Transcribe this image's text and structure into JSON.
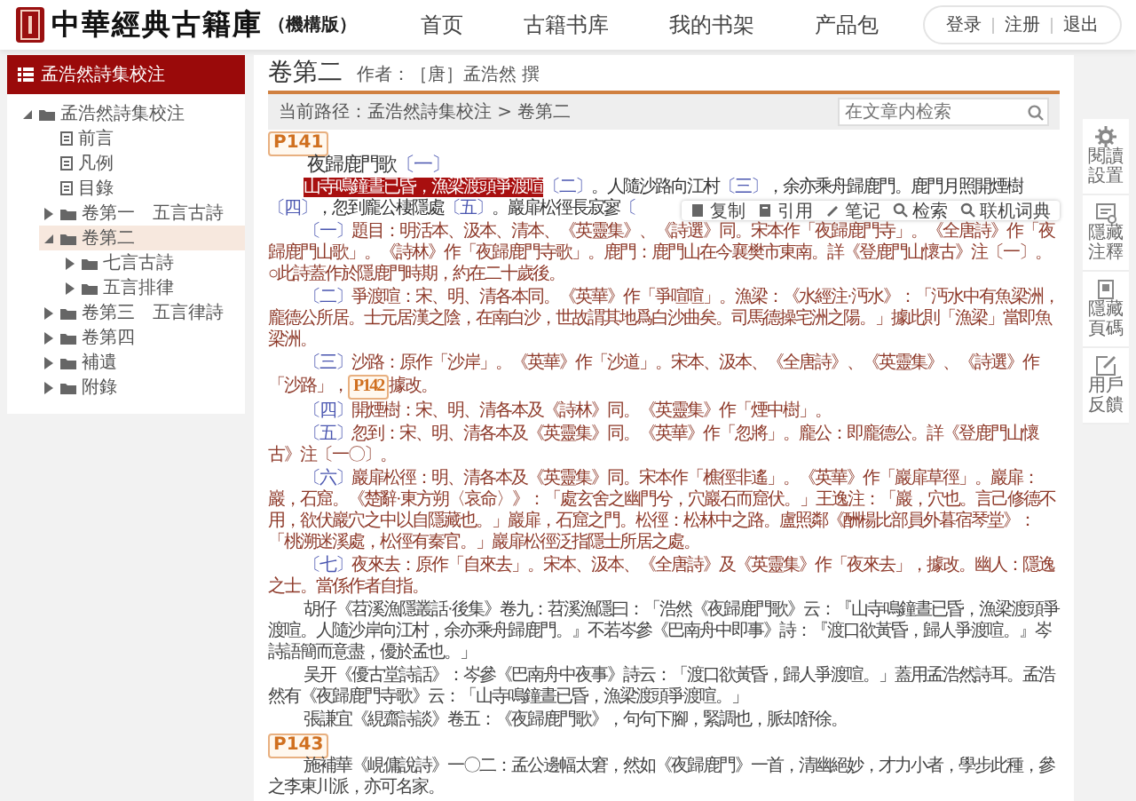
{
  "header": {
    "logo_title": "中華經典古籍庫",
    "edition": "（機構版）",
    "nav": [
      {
        "label": "首页"
      },
      {
        "label": "古籍书库"
      },
      {
        "label": "我的书架"
      },
      {
        "label": "产品包"
      }
    ],
    "account": [
      "登录",
      "注册",
      "退出"
    ]
  },
  "sidebar": {
    "title": "孟浩然詩集校注",
    "tree": [
      {
        "label": "孟浩然詩集校注",
        "kind": "folder",
        "expanded": true,
        "selected": false,
        "children": [
          {
            "label": "前言",
            "kind": "doc",
            "selected": false
          },
          {
            "label": "凡例",
            "kind": "doc",
            "selected": false
          },
          {
            "label": "目錄",
            "kind": "doc",
            "selected": false
          },
          {
            "label": "卷第一　五言古詩",
            "kind": "folder",
            "expanded": false,
            "selected": false
          },
          {
            "label": "卷第二",
            "kind": "folder",
            "expanded": true,
            "selected": true,
            "children": [
              {
                "label": "七言古詩",
                "kind": "folder",
                "expanded": false,
                "selected": false
              },
              {
                "label": "五言排律",
                "kind": "folder",
                "expanded": false,
                "selected": false
              }
            ]
          },
          {
            "label": "卷第三　五言律詩",
            "kind": "folder",
            "expanded": false,
            "selected": false
          },
          {
            "label": "卷第四",
            "kind": "folder",
            "expanded": false,
            "selected": false
          },
          {
            "label": "補遺",
            "kind": "folder",
            "expanded": false,
            "selected": false
          },
          {
            "label": "附錄",
            "kind": "folder",
            "expanded": false,
            "selected": false
          }
        ]
      }
    ]
  },
  "chapter": {
    "title": "卷第二",
    "author": "作者：［唐］孟浩然 撰"
  },
  "breadcrumb": "当前路径：孟浩然詩集校注 > 卷第二",
  "search": {
    "placeholder": "在文章内检索"
  },
  "content": [
    {
      "kind": "page",
      "text": "P141"
    },
    {
      "kind": "title",
      "parts": [
        {
          "kind": "text",
          "text": "夜歸鹿門歌"
        },
        {
          "kind": "ref",
          "text": "〔一〕"
        }
      ]
    },
    {
      "kind": "poem",
      "parts": [
        {
          "kind": "highlight",
          "text": "山寺鳴鐘晝已昏，漁梁渡頭爭渡喧"
        },
        {
          "kind": "ref",
          "text": "〔二〕"
        },
        {
          "kind": "text",
          "text": "。人隨沙路向江村"
        },
        {
          "kind": "ref",
          "text": "〔三〕"
        },
        {
          "kind": "text",
          "text": "，余亦乘舟歸鹿門。鹿門月照開煙樹"
        },
        {
          "kind": "ref",
          "text": "〔四〕"
        },
        {
          "kind": "text",
          "text": "，忽到龐公棲隱處"
        },
        {
          "kind": "ref",
          "text": "〔五〕"
        },
        {
          "kind": "text",
          "text": "。巖扉松徑長寂寥"
        },
        {
          "kind": "ref",
          "text": "〔"
        }
      ]
    },
    {
      "kind": "note",
      "parts": [
        {
          "kind": "ref",
          "text": "〔一〕"
        },
        {
          "kind": "text",
          "text": "題目：明活本、汲本、清本、《英靈集》、《詩選》同。宋本作「夜歸鹿門寺」。《全唐詩》作「夜歸鹿門山歌」。《詩林》作「夜歸鹿門寺歌」。鹿門：鹿門山在今襄樊市東南。詳《登鹿門山懷古》注〔一〕。○此詩蓋作於隱鹿門時期，約在二十歲後。"
        }
      ]
    },
    {
      "kind": "note",
      "parts": [
        {
          "kind": "ref",
          "text": "〔二〕"
        },
        {
          "kind": "text",
          "text": "爭渡喧：宋、明、清各本同。《英華》作「爭喧喧」。漁梁：《水經注·沔水》：「沔水中有魚梁洲，龐德公所居。士元居漢之陰，在南白沙，世故謂其地爲白沙曲矣。司馬德操宅洲之陽。」據此則「漁梁」當即魚梁洲。"
        }
      ]
    },
    {
      "kind": "note",
      "parts": [
        {
          "kind": "ref",
          "text": "〔三〕"
        },
        {
          "kind": "text",
          "text": "沙路：原作「沙岸」。《英華》作「沙道」。宋本、汲本、《全唐詩》、《英靈集》、《詩選》作「沙路」，"
        },
        {
          "kind": "page",
          "text": "P142"
        },
        {
          "kind": "text",
          "text": "據改。"
        }
      ]
    },
    {
      "kind": "note",
      "parts": [
        {
          "kind": "ref",
          "text": "〔四〕"
        },
        {
          "kind": "text",
          "text": "開煙樹：宋、明、清各本及《詩林》同。《英靈集》作「煙中樹」。"
        }
      ]
    },
    {
      "kind": "note",
      "parts": [
        {
          "kind": "ref",
          "text": "〔五〕"
        },
        {
          "kind": "text",
          "text": "忽到：宋、明、清各本及《英靈集》同。《英華》作「忽將」。龐公：即龐德公。詳《登鹿門山懷古》注〔一〇〕。"
        }
      ]
    },
    {
      "kind": "note",
      "parts": [
        {
          "kind": "ref",
          "text": "〔六〕"
        },
        {
          "kind": "text",
          "text": "巖扉松徑：明、清各本及《英靈集》同。宋本作「樵徑非遙」。《英華》作「巖扉草徑」。巖扉：巖，石窟。《楚辭·東方朔〈哀命〉》：「處玄舍之幽門兮，穴巖石而窟伏。」王逸注：「巖，穴也。言己修德不用，欲伏巖穴之中以自隱藏也。」巖扉，石窟之門。松徑：松林中之路。盧照鄰《酬楊比部員外暮宿琴堂》：「桃溯迷溪處，松徑有秦官。」巖扉松徑泛指隱士所居之處。"
        }
      ]
    },
    {
      "kind": "note",
      "parts": [
        {
          "kind": "ref",
          "text": "〔七〕"
        },
        {
          "kind": "text",
          "text": "夜來去：原作「自來去」。宋本、汲本、《全唐詩》及《英靈集》作「夜來去」，據改。幽人：隱逸之士。當係作者自指。"
        }
      ]
    },
    {
      "kind": "para",
      "parts": [
        {
          "kind": "text",
          "text": "胡仔《苕溪漁隱叢話·後集》卷九：苕溪漁隱曰：「浩然《夜歸鹿門歌》云：『山寺鳴鐘晝已昏，漁梁渡頭爭渡喧。人隨沙岸向江村，余亦乘舟歸鹿門。』不若岑參《巴南舟中即事》詩：『渡口欲黃昏，歸人爭渡喧。』岑詩語簡而意盡，優於孟也。」"
        }
      ]
    },
    {
      "kind": "para",
      "parts": [
        {
          "kind": "text",
          "text": "吴开《優古堂詩話》：岑參《巴南舟中夜事》詩云：「渡口欲黃昏，歸人爭渡喧。」蓋用孟浩然詩耳。孟浩然有《夜歸鹿門寺歌》云：「山寺鳴鐘晝已昏，漁梁渡頭爭渡喧。」"
        }
      ]
    },
    {
      "kind": "para",
      "parts": [
        {
          "kind": "text",
          "text": "張謙宜《絸齋詩談》卷五：《夜歸鹿門歌》，句句下腳，緊調也，脈却舒徐。"
        }
      ]
    },
    {
      "kind": "page",
      "text": "P143"
    },
    {
      "kind": "para",
      "parts": [
        {
          "kind": "text",
          "text": "施補華《峴傭說詩》一〇二：孟公邊幅太窘，然如《夜歸鹿門》一首，清幽絕妙，才力小者，學步此種，參之李東川派，亦可名家。"
        }
      ]
    }
  ],
  "selection_toolbar": [
    "复制",
    "引用",
    "笔记",
    "检索",
    "联机词典"
  ],
  "tools": [
    "閱讀設置",
    "隱藏注釋",
    "隱藏頁碼",
    "用戶反饋"
  ]
}
